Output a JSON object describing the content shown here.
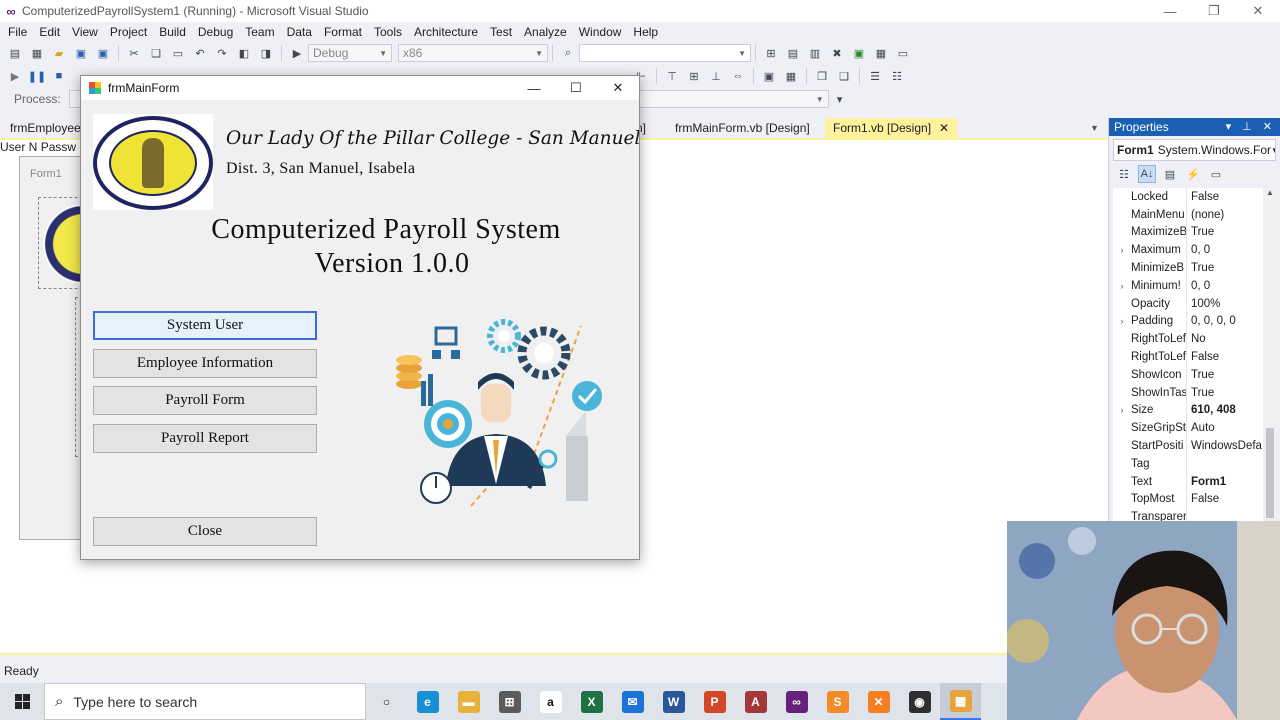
{
  "vs": {
    "title": "ComputerizedPayrollSystem1 (Running) - Microsoft Visual Studio",
    "menu": [
      "File",
      "Edit",
      "View",
      "Project",
      "Build",
      "Debug",
      "Team",
      "Data",
      "Format",
      "Tools",
      "Architecture",
      "Test",
      "Analyze",
      "Window",
      "Help"
    ],
    "config_value": "Debug",
    "platform_value": "x86",
    "process_label": "Process:",
    "tabs": {
      "employee": "frmEmployeeI",
      "partial": "n]",
      "mainform": "frmMainForm.vb [Design]",
      "form1": "Form1.vb [Design]"
    },
    "status": "Ready",
    "accent_color": "#fff29d"
  },
  "designer": {
    "form_caption": "Form1",
    "user_label": "User N",
    "pass_label": "Passw"
  },
  "main_form": {
    "title": "frmMainForm",
    "school_name": "Our Lady Of the Pillar College - San Manuel Inc.",
    "school_address": "Dist. 3, San Manuel, Isabela",
    "system_title": "Computerized Payroll System",
    "version": "Version 1.0.0",
    "buttons": {
      "system_user": "System User",
      "employee_info": "Employee Information",
      "payroll_form": "Payroll Form",
      "payroll_report": "Payroll Report",
      "close": "Close"
    }
  },
  "properties": {
    "title": "Properties",
    "object_name": "Form1",
    "object_type": "System.Windows.For",
    "rows": [
      {
        "name": "Locked",
        "value": "False",
        "expand": false,
        "bold": false
      },
      {
        "name": "MainMenu",
        "value": "(none)",
        "expand": false,
        "bold": false
      },
      {
        "name": "MaximizeB",
        "value": "True",
        "expand": false,
        "bold": false
      },
      {
        "name": "Maximum",
        "value": "0, 0",
        "expand": true,
        "bold": false
      },
      {
        "name": "MinimizeB",
        "value": "True",
        "expand": false,
        "bold": false
      },
      {
        "name": "Minimum!",
        "value": "0, 0",
        "expand": true,
        "bold": false
      },
      {
        "name": "Opacity",
        "value": "100%",
        "expand": false,
        "bold": false
      },
      {
        "name": "Padding",
        "value": "0, 0, 0, 0",
        "expand": true,
        "bold": false
      },
      {
        "name": "RightToLef",
        "value": "No",
        "expand": false,
        "bold": false
      },
      {
        "name": "RightToLef",
        "value": "False",
        "expand": false,
        "bold": false
      },
      {
        "name": "ShowIcon",
        "value": "True",
        "expand": false,
        "bold": false
      },
      {
        "name": "ShowInTas",
        "value": "True",
        "expand": false,
        "bold": false
      },
      {
        "name": "Size",
        "value": "610, 408",
        "expand": true,
        "bold": true
      },
      {
        "name": "SizeGripSty",
        "value": "Auto",
        "expand": false,
        "bold": false
      },
      {
        "name": "StartPositi",
        "value": "WindowsDefa",
        "expand": false,
        "bold": false
      },
      {
        "name": "Tag",
        "value": "",
        "expand": false,
        "bold": false
      },
      {
        "name": "Text",
        "value": "Form1",
        "expand": false,
        "bold": true
      },
      {
        "name": "TopMost",
        "value": "False",
        "expand": false,
        "bold": false
      },
      {
        "name": "Transparer",
        "value": "",
        "expand": false,
        "bold": false
      }
    ]
  },
  "taskbar": {
    "search_placeholder": "Type here to search",
    "apps": [
      {
        "icon": "cortana-icon",
        "glyph": "○",
        "color": "transparent",
        "text_color": "#222"
      },
      {
        "icon": "edge-icon",
        "glyph": "e",
        "color": "#1b8fd6",
        "text_color": "#fff"
      },
      {
        "icon": "file-explorer-icon",
        "glyph": "▬",
        "color": "#e8b23a",
        "text_color": "#fff"
      },
      {
        "icon": "store-icon",
        "glyph": "⊞",
        "color": "#5b5b5b",
        "text_color": "#fff"
      },
      {
        "icon": "amazon-icon",
        "glyph": "a",
        "color": "#ffffff",
        "text_color": "#111"
      },
      {
        "icon": "excel-icon",
        "glyph": "X",
        "color": "#1e7145",
        "text_color": "#fff"
      },
      {
        "icon": "mail-icon",
        "glyph": "✉",
        "color": "#1a73d9",
        "text_color": "#fff"
      },
      {
        "icon": "word-icon",
        "glyph": "W",
        "color": "#2b579a",
        "text_color": "#fff"
      },
      {
        "icon": "powerpoint-icon",
        "glyph": "P",
        "color": "#d24726",
        "text_color": "#fff"
      },
      {
        "icon": "access-icon",
        "glyph": "A",
        "color": "#a4373a",
        "text_color": "#fff"
      },
      {
        "icon": "visual-studio-icon",
        "glyph": "∞",
        "color": "#68217a",
        "text_color": "#fff"
      },
      {
        "icon": "sublime-icon",
        "glyph": "S",
        "color": "#f28c28",
        "text_color": "#fff"
      },
      {
        "icon": "xampp-icon",
        "glyph": "✕",
        "color": "#f57f20",
        "text_color": "#fff"
      },
      {
        "icon": "obs-icon",
        "glyph": "◉",
        "color": "#302e31",
        "text_color": "#fff"
      },
      {
        "icon": "running-app-icon",
        "glyph": "▦",
        "color": "#e8a33a",
        "text_color": "#fff"
      }
    ]
  }
}
